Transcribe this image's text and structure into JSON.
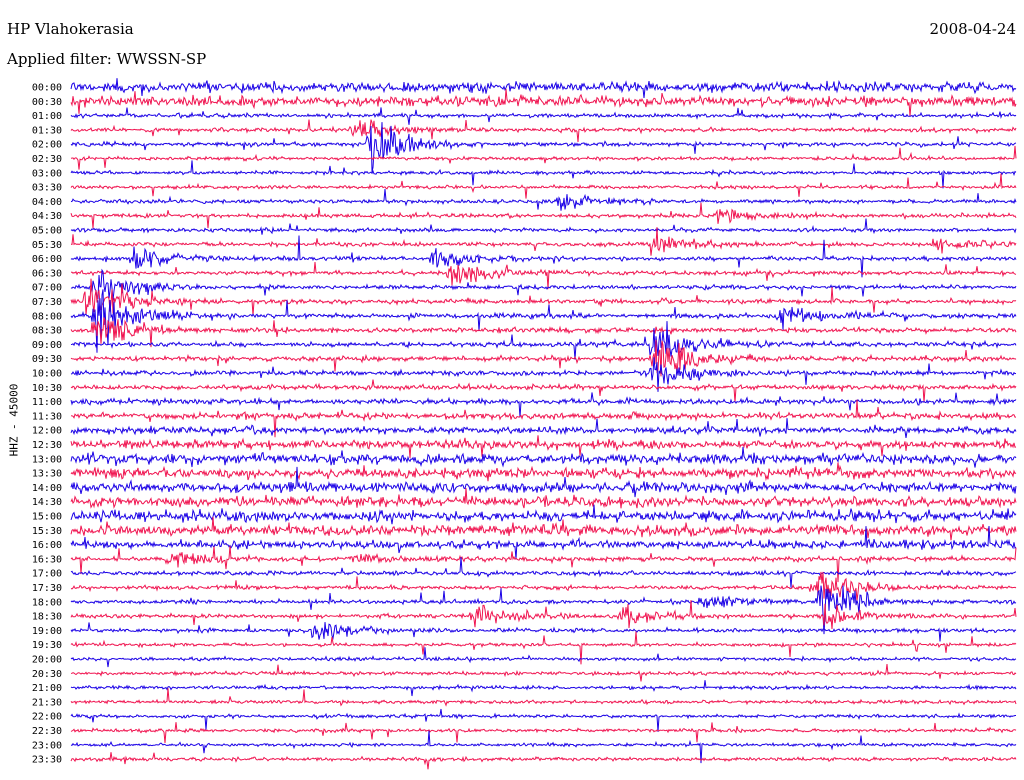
{
  "header": {
    "station": "HP Vlahokerasia",
    "date": "2008-04-24",
    "filter_label": "Applied filter: WWSSN-SP"
  },
  "chart_data": {
    "type": "line",
    "title": "HP Vlahokerasia",
    "subtitle": "Applied filter: WWSSN-SP",
    "date": "2008-04-24",
    "ylabel": "HHZ - 45000",
    "xlabel": "",
    "grid": false,
    "legend": "none",
    "trace_colors": [
      "#1a00e6",
      "#f01450"
    ],
    "categories": [
      "00:00",
      "00:30",
      "01:00",
      "01:30",
      "02:00",
      "02:30",
      "03:00",
      "03:30",
      "04:00",
      "04:30",
      "05:00",
      "05:30",
      "06:00",
      "06:30",
      "07:00",
      "07:30",
      "08:00",
      "08:30",
      "09:00",
      "09:30",
      "10:00",
      "10:30",
      "11:00",
      "11:30",
      "12:00",
      "12:30",
      "13:00",
      "13:30",
      "14:00",
      "14:30",
      "15:00",
      "15:30",
      "16:00",
      "16:30",
      "17:00",
      "17:30",
      "18:00",
      "18:30",
      "19:00",
      "19:30",
      "20:00",
      "20:30",
      "21:00",
      "21:30",
      "22:00",
      "22:30",
      "23:00",
      "23:30"
    ],
    "noise_level": [
      0.75,
      0.75,
      0.3,
      0.3,
      0.3,
      0.25,
      0.25,
      0.25,
      0.3,
      0.3,
      0.3,
      0.3,
      0.3,
      0.3,
      0.3,
      0.35,
      0.35,
      0.35,
      0.35,
      0.35,
      0.35,
      0.35,
      0.4,
      0.45,
      0.5,
      0.65,
      0.75,
      0.75,
      0.75,
      0.75,
      0.8,
      0.8,
      0.6,
      0.35,
      0.3,
      0.3,
      0.3,
      0.3,
      0.3,
      0.25,
      0.25,
      0.25,
      0.25,
      0.25,
      0.25,
      0.25,
      0.25,
      0.25
    ],
    "events": [
      {
        "row": 4,
        "minute": 9.5,
        "amplitude": 2.6
      },
      {
        "row": 3,
        "minute": 9.0,
        "amplitude": 1.2
      },
      {
        "row": 8,
        "minute": 15.5,
        "amplitude": 0.7
      },
      {
        "row": 9,
        "minute": 20.5,
        "amplitude": 0.9
      },
      {
        "row": 11,
        "minute": 18.5,
        "amplitude": 1.2
      },
      {
        "row": 11,
        "minute": 27.5,
        "amplitude": 1.0
      },
      {
        "row": 12,
        "minute": 2.0,
        "amplitude": 1.4
      },
      {
        "row": 12,
        "minute": 11.5,
        "amplitude": 1.2
      },
      {
        "row": 13,
        "minute": 12.0,
        "amplitude": 1.6
      },
      {
        "row": 14,
        "minute": 0.8,
        "amplitude": 2.4
      },
      {
        "row": 15,
        "minute": 0.5,
        "amplitude": 2.0
      },
      {
        "row": 16,
        "minute": 0.8,
        "amplitude": 3.2
      },
      {
        "row": 17,
        "minute": 0.8,
        "amplitude": 1.8
      },
      {
        "row": 18,
        "minute": 18.5,
        "amplitude": 2.5
      },
      {
        "row": 19,
        "minute": 18.5,
        "amplitude": 2.8
      },
      {
        "row": 20,
        "minute": 18.5,
        "amplitude": 1.6
      },
      {
        "row": 16,
        "minute": 22.5,
        "amplitude": 1.0
      },
      {
        "row": 36,
        "minute": 23.8,
        "amplitude": 3.0
      },
      {
        "row": 35,
        "minute": 23.6,
        "amplitude": 1.6
      },
      {
        "row": 37,
        "minute": 23.9,
        "amplitude": 1.2
      },
      {
        "row": 38,
        "minute": 7.8,
        "amplitude": 1.2
      },
      {
        "row": 37,
        "minute": 12.8,
        "amplitude": 1.3
      },
      {
        "row": 37,
        "minute": 17.5,
        "amplitude": 1.0
      },
      {
        "row": 36,
        "minute": 20.0,
        "amplitude": 0.8
      },
      {
        "row": 33,
        "minute": 3.2,
        "amplitude": 0.8
      },
      {
        "row": 33,
        "minute": 9.0,
        "amplitude": 0.6
      }
    ]
  }
}
